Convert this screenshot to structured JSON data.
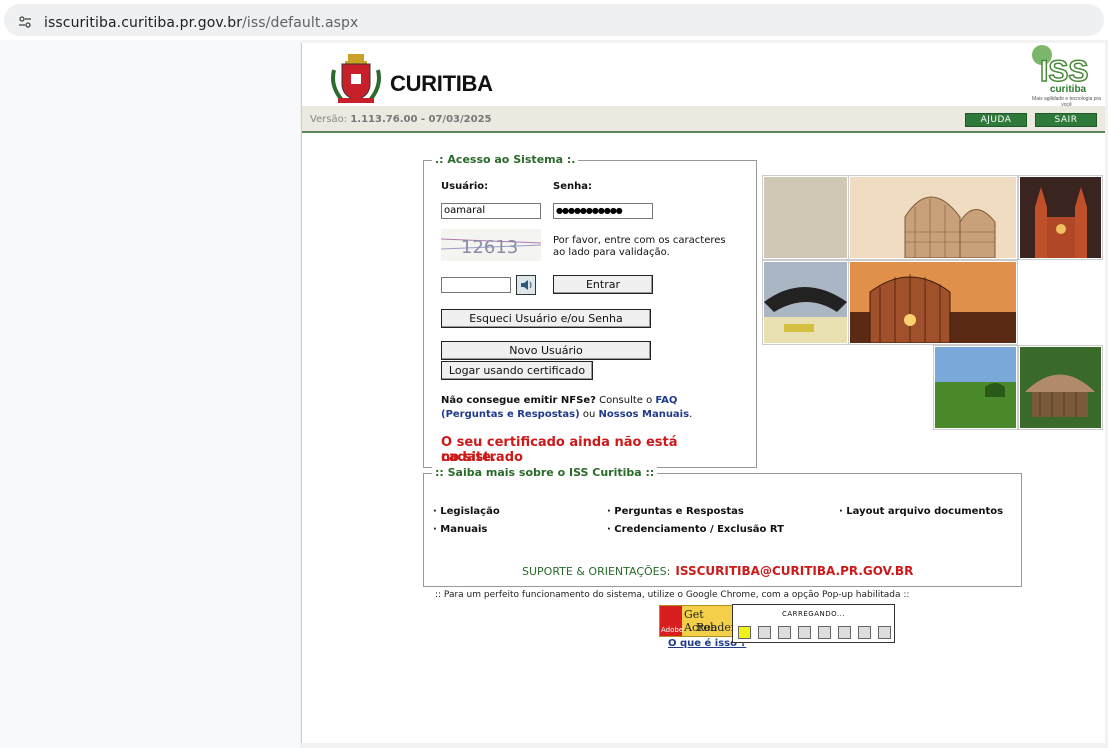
{
  "browser": {
    "url_host": "isscuritiba.curitiba.pr.gov.br",
    "url_path": "/iss/default.aspx"
  },
  "header": {
    "city_name": "CURITIBA",
    "iss_logo_text": "ISS",
    "iss_logo_city": "curitiba",
    "iss_tagline": "Mais agilidade e tecnologia pra você",
    "version_label": "Versão:",
    "version_value": "1.113.76.00 - 07/03/2025",
    "help_button": "AJUDA",
    "exit_button": "SAIR"
  },
  "login": {
    "legend": ".: Acesso ao Sistema :.",
    "user_label": "Usuário:",
    "password_label": "Senha:",
    "user_value": "oamaral",
    "password_value": "●●●●●●●●●●●",
    "captcha_text": "12613",
    "captcha_hint_line1": "Por favor, entre com os caracteres",
    "captcha_hint_line2": "ao lado para validação.",
    "captcha_input_value": "",
    "enter_button": "Entrar",
    "forgot_button": "Esqueci Usuário e/ou Senha",
    "new_user_button": "Novo Usuário",
    "certificate_button": "Logar usando certificado",
    "help_q": "Não consegue emitir NFSe?",
    "help_consult": "Consulte o",
    "help_faq": "FAQ",
    "help_faq2": "(Perguntas e Respostas)",
    "help_or": "ou",
    "help_manuals": "Nossos Manuais",
    "error_line1": "O seu certificado ainda não está cadastrado",
    "error_line2": "no site."
  },
  "info": {
    "legend": ":: Saiba mais sobre o ISS Curitiba ::",
    "links": [
      "· Legislação",
      "· Perguntas e Respostas",
      "· Layout arquivo documentos",
      "· Manuais",
      "· Credenciamento / Exclusão RT"
    ],
    "support_label": "SUPORTE & ORIENTAÇÕES:",
    "support_email": "ISSCURITIBA@CURITIBA.PR.GOV.BR"
  },
  "footer": {
    "browser_note": ":: Para um perfeito funcionamento do sistema, utilize o Google Chrome, com a opção Pop-up habilitada ::",
    "acrobat_line1": "Get Acrob",
    "acrobat_line2": "Reader",
    "acrobat_brand": "Adobe",
    "what_is_link": "O que é isso ?"
  },
  "loader": {
    "title": "CARREGANDO...",
    "active_index": 0,
    "squares": 8
  },
  "colors": {
    "green": "#2a6a2a",
    "error_red": "#cc1a1a",
    "link_blue": "#1f3a8a",
    "header_band": "#ebe9e0"
  }
}
